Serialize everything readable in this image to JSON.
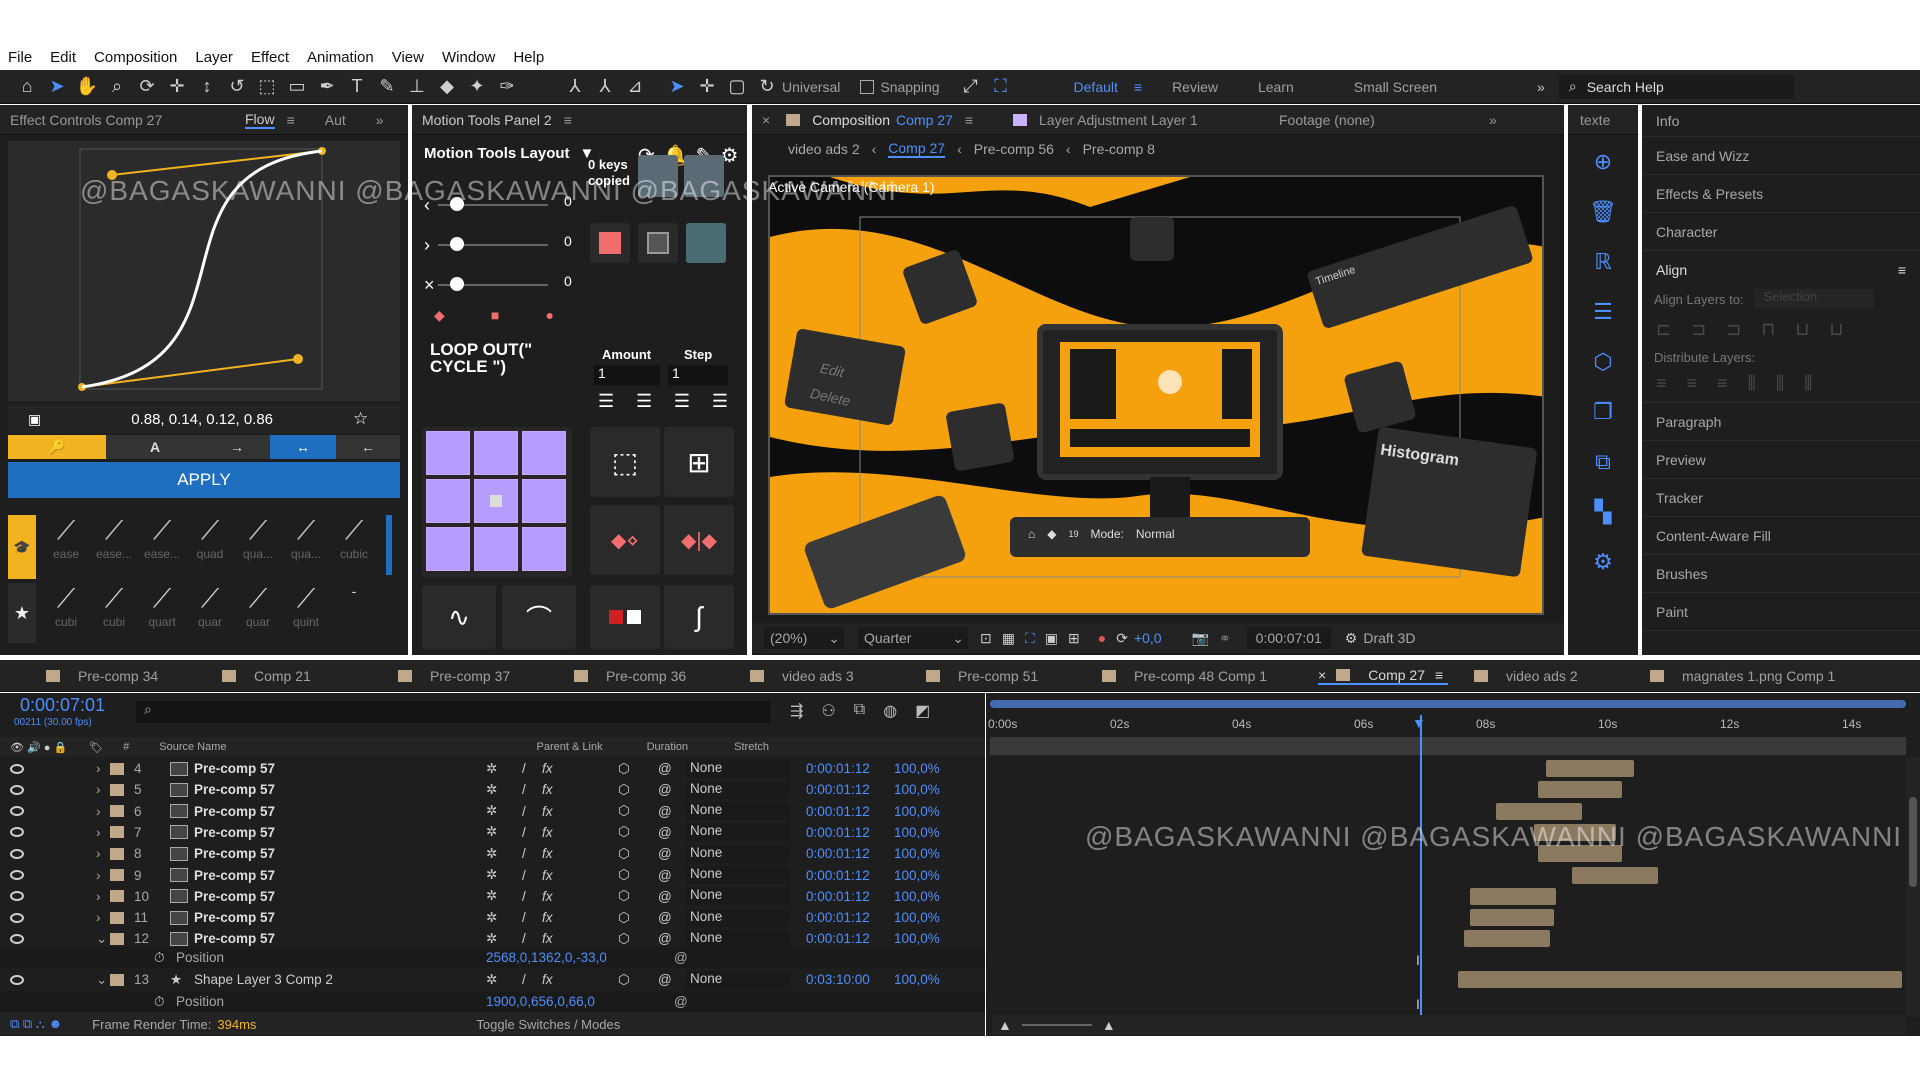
{
  "menu": [
    "File",
    "Edit",
    "Composition",
    "Layer",
    "Effect",
    "Animation",
    "View",
    "Window",
    "Help"
  ],
  "toolbar": {
    "universal": "Universal",
    "snapping": "Snapping",
    "workspaces": [
      "Default",
      "Review",
      "Learn",
      "Small Screen"
    ],
    "search_placeholder": "Search Help"
  },
  "effect_controls": {
    "title": "Effect Controls Comp 27",
    "flow_tab": "Flow",
    "auto_tab": "Aut",
    "bezier_values": "0.88, 0.14, 0.12, 0.86",
    "apply": "APPLY",
    "presets_row1": [
      "ease",
      "ease...",
      "ease...",
      "quad",
      "qua...",
      "qua...",
      "cubic"
    ],
    "presets_row2": [
      "cubi",
      "cubi",
      "quart",
      "quar",
      "quar",
      "quint",
      "-"
    ]
  },
  "motion_tools": {
    "title": "Motion Tools Panel 2",
    "layout": "Motion Tools Layout",
    "slider_values": [
      "0",
      "0",
      "0"
    ],
    "keys_copied": "0 keys copied",
    "loop_text": "LOOP OUT(\" CYCLE \")",
    "amount_label": "Amount",
    "step_label": "Step",
    "amount_value": "1",
    "step_value": "1"
  },
  "composition": {
    "tab_title": "Composition",
    "comp_name": "Comp 27",
    "layer_title": "Layer  Adjustment Layer 1",
    "footage_title": "Footage  (none)",
    "breadcrumbs": [
      "video ads 2",
      "Comp 27",
      "Pre-comp 56",
      "Pre-comp 8"
    ],
    "camera": "Active Camera (Camera 1)",
    "zoom": "(20%)",
    "quality": "Quarter",
    "exposure": "+0,0",
    "timecode": "0:00:07:01",
    "renderer": "Draft 3D",
    "mode_label": "Mode:",
    "mode_value": "Normal",
    "timeline_card": "Timeline",
    "histogram_card": "Histogram",
    "edit_card": "Edit",
    "delete_card": "Delete",
    "counter": "19"
  },
  "side_panel": {
    "partial_title": "texte",
    "items": [
      "Info",
      "Ease and Wizz",
      "Effects & Presets",
      "Character",
      "Align"
    ],
    "align_layers_to": "Align Layers to:",
    "selection": "Selection",
    "distribute": "Distribute Layers:",
    "items2": [
      "Paragraph",
      "Preview",
      "Tracker",
      "Content-Aware Fill",
      "Brushes",
      "Paint"
    ]
  },
  "timeline_tabs": [
    "Pre-comp 34",
    "Comp 21",
    "Pre-comp 37",
    "Pre-comp 36",
    "video ads 3",
    "Pre-comp 51",
    "Pre-comp 48 Comp 1",
    "Comp 27",
    "video ads 2",
    "magnates 1.png Comp 1"
  ],
  "timeline": {
    "current_time": "0:00:07:01",
    "frames": "00211 (30.00 fps)",
    "headers": {
      "source": "Source Name",
      "parent": "Parent & Link",
      "duration": "Duration",
      "stretch": "Stretch",
      "num": "#"
    },
    "ruler": [
      "0:00s",
      "02s",
      "04s",
      "06s",
      "08s",
      "10s",
      "12s",
      "14s"
    ],
    "layers": [
      {
        "num": "4",
        "name": "Pre-comp 57",
        "parent": "None",
        "duration": "0:00:01:12",
        "stretch": "100,0%"
      },
      {
        "num": "5",
        "name": "Pre-comp 57",
        "parent": "None",
        "duration": "0:00:01:12",
        "stretch": "100,0%"
      },
      {
        "num": "6",
        "name": "Pre-comp 57",
        "parent": "None",
        "duration": "0:00:01:12",
        "stretch": "100,0%"
      },
      {
        "num": "7",
        "name": "Pre-comp 57",
        "parent": "None",
        "duration": "0:00:01:12",
        "stretch": "100,0%"
      },
      {
        "num": "8",
        "name": "Pre-comp 57",
        "parent": "None",
        "duration": "0:00:01:12",
        "stretch": "100,0%"
      },
      {
        "num": "9",
        "name": "Pre-comp 57",
        "parent": "None",
        "duration": "0:00:01:12",
        "stretch": "100,0%"
      },
      {
        "num": "10",
        "name": "Pre-comp 57",
        "parent": "None",
        "duration": "0:00:01:12",
        "stretch": "100,0%"
      },
      {
        "num": "11",
        "name": "Pre-comp 57",
        "parent": "None",
        "duration": "0:00:01:12",
        "stretch": "100,0%"
      },
      {
        "num": "12",
        "name": "Pre-comp 57",
        "parent": "None",
        "duration": "0:00:01:12",
        "stretch": "100,0%"
      }
    ],
    "position_label": "Position",
    "position_12": "2568,0,1362,0,-33,0",
    "layer13": {
      "num": "13",
      "name": "Shape Layer 3 Comp 2",
      "parent": "None",
      "duration": "0:03:10:00",
      "stretch": "100,0%"
    },
    "position_13": "1900,0,656,0,66,0",
    "frame_render_label": "Frame Render Time:",
    "frame_render_value": "394ms",
    "toggle": "Toggle Switches / Modes"
  },
  "watermark": "@BAGASKAWANNI @BAGASKAWANNI @BAGASKAWANNI"
}
